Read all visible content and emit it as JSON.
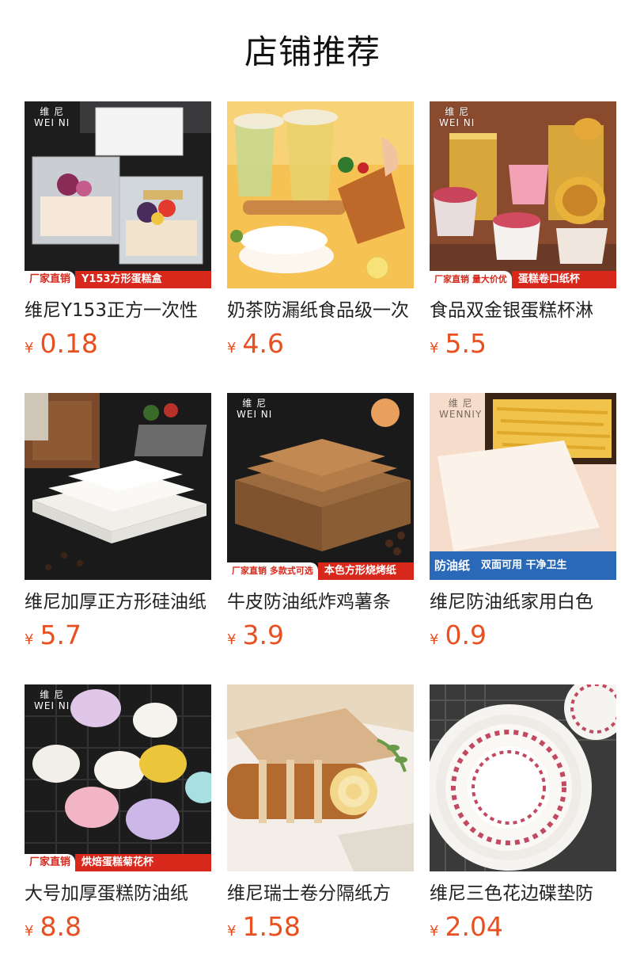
{
  "header": {
    "title": "店铺推荐"
  },
  "products": [
    {
      "name": "维尼Y153正方一次性",
      "currency": "¥",
      "price": "0.18",
      "brand": [
        "维 尼",
        "WEI NI"
      ],
      "banner": [
        "厂家直销",
        "Y153方形蛋糕盒"
      ],
      "image": "cake-box"
    },
    {
      "name": "奶茶防漏纸食品级一次",
      "currency": "¥",
      "price": "4.6",
      "brand": [],
      "banner": [],
      "image": "milk-tea"
    },
    {
      "name": "食品双金银蛋糕杯淋",
      "currency": "¥",
      "price": "5.5",
      "brand": [
        "维 尼",
        "WEI NI"
      ],
      "banner": [
        "厂家直销 量大价优",
        "蛋糕卷口纸杯"
      ],
      "image": "gold-cups"
    },
    {
      "name": "维尼加厚正方形硅油纸",
      "currency": "¥",
      "price": "5.7",
      "brand": [],
      "banner": [],
      "image": "white-paper"
    },
    {
      "name": "牛皮防油纸炸鸡薯条",
      "currency": "¥",
      "price": "3.9",
      "brand": [
        "维 尼",
        "WEI NI"
      ],
      "banner": [
        "厂家直销 多款式可选",
        "本色方形烧烤纸"
      ],
      "image": "kraft-paper"
    },
    {
      "name": "维尼防油纸家用白色",
      "currency": "¥",
      "price": "0.9",
      "brand": [
        "维 尼",
        "WENNIY"
      ],
      "banner": [
        "防油纸",
        "双面可用 干净卫生"
      ],
      "image": "fries-paper"
    },
    {
      "name": "大号加厚蛋糕防油纸",
      "currency": "¥",
      "price": "8.8",
      "brand": [
        "维 尼",
        "WEI NI"
      ],
      "banner": [
        "厂家直销",
        "烘焙蛋糕菊花杯"
      ],
      "image": "chrysanthemum-cups"
    },
    {
      "name": "维尼瑞士卷分隔纸方",
      "currency": "¥",
      "price": "1.58",
      "brand": [],
      "banner": [],
      "image": "swiss-roll"
    },
    {
      "name": "维尼三色花边碟垫防",
      "currency": "¥",
      "price": "2.04",
      "brand": [],
      "banner": [],
      "image": "lace-doily"
    }
  ],
  "colors": {
    "price": "#e8501f",
    "banner_red": "#d8281c"
  }
}
